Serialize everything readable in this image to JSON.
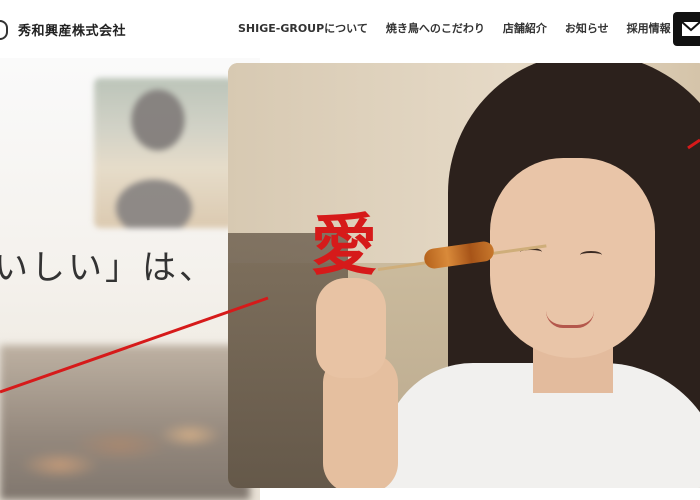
{
  "header": {
    "company_name": "秀和興産株式会社",
    "nav": [
      {
        "label": "SHIGE-GROUPについて"
      },
      {
        "label": "焼き鳥へのこだわり"
      },
      {
        "label": "店舗紹介"
      },
      {
        "label": "お知らせ"
      },
      {
        "label": "採用情報"
      }
    ],
    "mail_icon": "mail-icon"
  },
  "hero": {
    "catch_text": "いしい」は、",
    "accent_char": "愛",
    "accent_color": "#d61a1a"
  }
}
